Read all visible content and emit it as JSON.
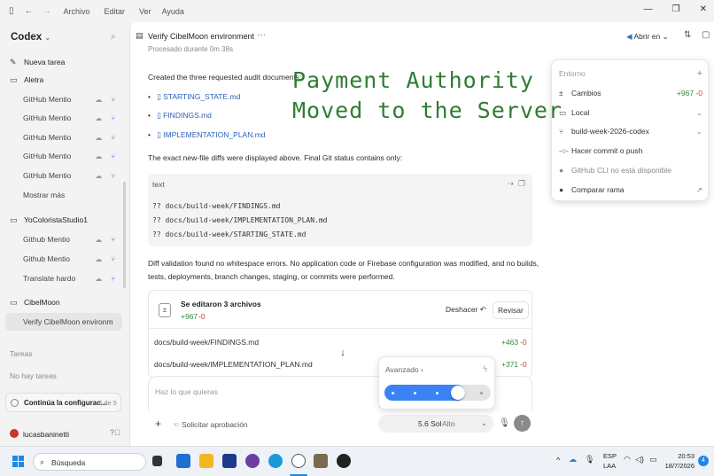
{
  "titlebar": {
    "menus": [
      "Archivo",
      "Editar",
      "Ver",
      "Ayuda"
    ]
  },
  "sidebar": {
    "app_name": "Codex",
    "new_task": "Nueva tarea",
    "groups": [
      {
        "name": "Aletra",
        "items": [
          "GitHub Mentio",
          "GitHub Mentio",
          "GitHub Mentio",
          "GitHub Mentio",
          "GitHub Mentio"
        ],
        "more": "Mostrar más"
      },
      {
        "name": "YoColoristaStudio1",
        "items": [
          "Github Mentio",
          "Github Mentio",
          "Translate hardo"
        ]
      },
      {
        "name": "CibelMoon",
        "items": [
          "Verify CibelMoon environm"
        ]
      }
    ],
    "tasks_header": "Tareas",
    "no_tasks": "No hay tareas",
    "progress_label": "Continúa la configurac...",
    "progress_count": "2 de 5",
    "user": "lucasbaninetti"
  },
  "header": {
    "title": "Verify CibelMoon environment",
    "more": "···",
    "open_in": "Abrir en"
  },
  "conversation": {
    "processed": "Procesado durante 0m 38s",
    "created_text": "Created the three requested audit documents:",
    "files": [
      "STARTING_STATE.md",
      "FINDINGS.md",
      "IMPLEMENTATION_PLAN.md"
    ],
    "diffs_text": "The exact new-file diffs were displayed above. Final Git status contains only:",
    "code_lang": "text",
    "code_lines": [
      "?? docs/build-week/FINDINGS.md",
      "?? docs/build-week/IMPLEMENTATION_PLAN.md",
      "?? docs/build-week/STARTING_STATE.md"
    ],
    "validation_line1": "Diff validation found no whitespace errors. No application code or Firebase configuration was modified, and no builds,",
    "validation_line2": "tests, deployments, branch changes, staging, or commits were performed."
  },
  "edited": {
    "title": "Se editaron 3 archivos",
    "added": "+967",
    "removed": "-0",
    "undo": "Deshacer",
    "review": "Revisar",
    "rows": [
      {
        "path": "docs/build-week/FINDINGS.md",
        "added": "+463",
        "removed": "-0"
      },
      {
        "path": "docs/build-week/IMPLEMENTATION_PLAN.md",
        "added": "+371",
        "removed": "-0"
      }
    ]
  },
  "composer": {
    "placeholder": "Haz lo que quieras",
    "approval": "Solicitar aprobación",
    "model": "5.6 Sol",
    "effort": "Alto"
  },
  "slider": {
    "label": "Avanzado",
    "level": 0.72
  },
  "environment": {
    "title": "Entorno",
    "changes_label": "Cambios",
    "changes_added": "+967",
    "changes_removed": "-0",
    "local_label": "Local",
    "branch": "build-week-2026-codex",
    "commit_push": "Hacer commit o push",
    "gh_cli": "GitHub CLI no está disponible",
    "compare": "Comparar rama"
  },
  "overlay": {
    "line1": "Payment Authority",
    "line2": "Moved to the Server"
  },
  "taskbar": {
    "search": "Búsqueda",
    "lang1": "ESP",
    "lang2": "LAA",
    "time": "20:53",
    "date": "18/7/2026",
    "notif": "4"
  },
  "colors": {
    "accent": "#3b82f6",
    "added": "#2e8b3d",
    "removed": "#c8463a",
    "overlay_text": "#2e7d32"
  }
}
